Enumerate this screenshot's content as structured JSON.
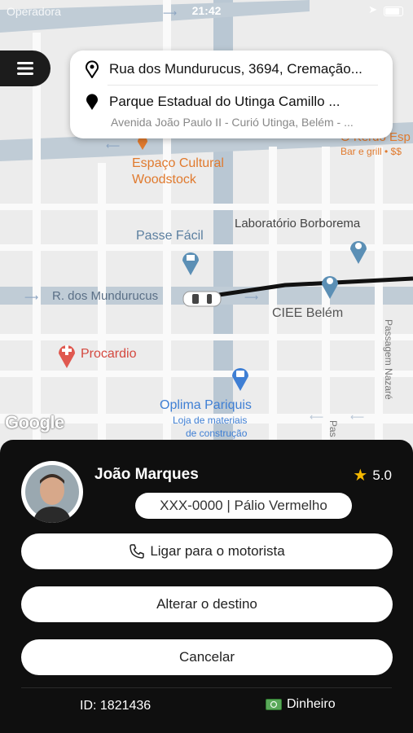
{
  "status_bar": {
    "carrier": "Operadora",
    "time": "21:42"
  },
  "route": {
    "origin": "Rua dos Mundurucus, 3694, Cremação...",
    "destination": "Parque Estadual do Utinga Camillo ...",
    "destination_address": "Avenida João Paulo II - Curió Utinga, Belém - ..."
  },
  "map": {
    "labels": {
      "restaurant_name": "O Kerdo Esp",
      "restaurant_info": "Bar e grill • $$",
      "espaco_cultural_1": "Espaço Cultural",
      "espaco_cultural_2": "Woodstock",
      "laboratorio": "Laboratório Borborema",
      "passe_facil": "Passe Fácil",
      "street_mundurucus": "R. dos Mundurucus",
      "ciee": "CIEE Belém",
      "procardio": "Procardio",
      "oplima": "Oplima Pariquis",
      "oplima_sub_1": "Loja de materiais",
      "oplima_sub_2": "de construção",
      "passagem": "Passagem Nazaré",
      "pas": "Pas"
    },
    "google": "Google"
  },
  "driver": {
    "name": "João Marques",
    "rating": "5.0",
    "vehicle": "XXX-0000 | Pálio Vermelho"
  },
  "actions": {
    "call": "Ligar para o motorista",
    "change_destination": "Alterar o destino",
    "cancel": "Cancelar"
  },
  "footer": {
    "ride_id": "ID: 1821436",
    "payment": "Dinheiro"
  },
  "colors": {
    "accent_orange": "#e07a2e",
    "poi_blue": "#5b8fb5",
    "medical_red": "#e0584f",
    "shopping_blue": "#3f7fd4"
  }
}
